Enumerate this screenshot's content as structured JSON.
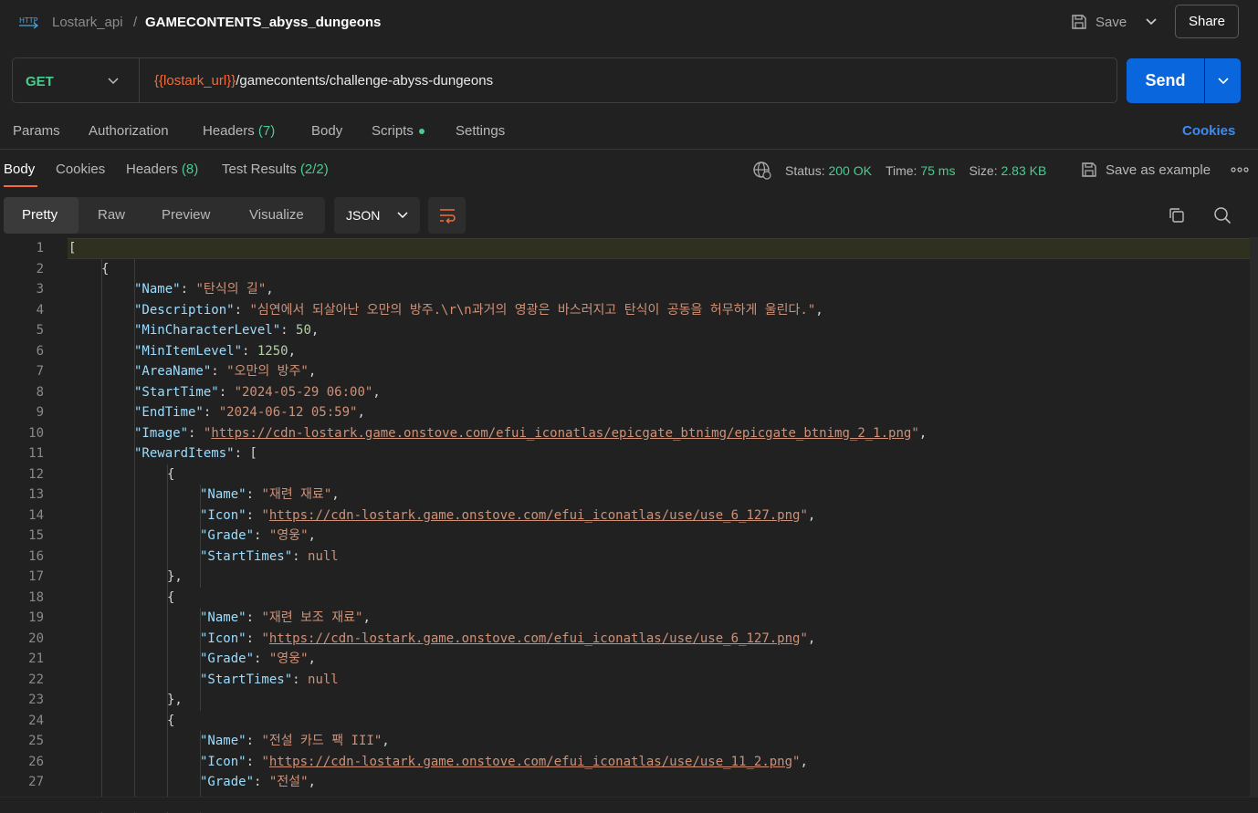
{
  "header": {
    "collection": "Lostark_api",
    "separator": "/",
    "title": "GAMECONTENTS_abyss_dungeons",
    "save_label": "Save",
    "share_label": "Share"
  },
  "request": {
    "method": "GET",
    "url_var": "{{lostark_url}}",
    "url_path": "/gamecontents/challenge-abyss-dungeons",
    "send_label": "Send"
  },
  "request_tabs": {
    "params": "Params",
    "authorization": "Authorization",
    "headers": "Headers",
    "headers_count": "(7)",
    "body": "Body",
    "scripts": "Scripts",
    "settings": "Settings",
    "cookies": "Cookies"
  },
  "response_tabs": {
    "body": "Body",
    "cookies": "Cookies",
    "headers": "Headers",
    "headers_count": "(8)",
    "tests": "Test Results",
    "tests_count": "(2/2)"
  },
  "status": {
    "status_label": "Status:",
    "status_value": "200 OK",
    "time_label": "Time:",
    "time_value": "75 ms",
    "size_label": "Size:",
    "size_value": "2.83 KB",
    "save_example": "Save as example"
  },
  "view": {
    "pretty": "Pretty",
    "raw": "Raw",
    "preview": "Preview",
    "visualize": "Visualize",
    "format": "JSON"
  },
  "code_lines": [
    {
      "n": "1",
      "indent": 0,
      "parts": [
        [
          "p",
          "["
        ]
      ]
    },
    {
      "n": "2",
      "indent": 1,
      "parts": [
        [
          "p",
          "{"
        ]
      ]
    },
    {
      "n": "3",
      "indent": 2,
      "parts": [
        [
          "k",
          "\"Name\""
        ],
        [
          "p",
          ": "
        ],
        [
          "s",
          "\"탄식의 길\""
        ],
        [
          "p",
          ","
        ]
      ]
    },
    {
      "n": "4",
      "indent": 2,
      "parts": [
        [
          "k",
          "\"Description\""
        ],
        [
          "p",
          ": "
        ],
        [
          "s",
          "\"심연에서 되살아난 오만의 방주.\\r\\n과거의 영광은 바스러지고 탄식이 공동을 허무하게 울린다.\""
        ],
        [
          "p",
          ","
        ]
      ]
    },
    {
      "n": "5",
      "indent": 2,
      "parts": [
        [
          "k",
          "\"MinCharacterLevel\""
        ],
        [
          "p",
          ": "
        ],
        [
          "n",
          "50"
        ],
        [
          "p",
          ","
        ]
      ]
    },
    {
      "n": "6",
      "indent": 2,
      "parts": [
        [
          "k",
          "\"MinItemLevel\""
        ],
        [
          "p",
          ": "
        ],
        [
          "n",
          "1250"
        ],
        [
          "p",
          ","
        ]
      ]
    },
    {
      "n": "7",
      "indent": 2,
      "parts": [
        [
          "k",
          "\"AreaName\""
        ],
        [
          "p",
          ": "
        ],
        [
          "s",
          "\"오만의 방주\""
        ],
        [
          "p",
          ","
        ]
      ]
    },
    {
      "n": "8",
      "indent": 2,
      "parts": [
        [
          "k",
          "\"StartTime\""
        ],
        [
          "p",
          ": "
        ],
        [
          "s",
          "\"2024-05-29 06:00\""
        ],
        [
          "p",
          ","
        ]
      ]
    },
    {
      "n": "9",
      "indent": 2,
      "parts": [
        [
          "k",
          "\"EndTime\""
        ],
        [
          "p",
          ": "
        ],
        [
          "s",
          "\"2024-06-12 05:59\""
        ],
        [
          "p",
          ","
        ]
      ]
    },
    {
      "n": "10",
      "indent": 2,
      "parts": [
        [
          "k",
          "\"Image\""
        ],
        [
          "p",
          ": "
        ],
        [
          "s",
          "\""
        ],
        [
          "u",
          "https://cdn-lostark.game.onstove.com/efui_iconatlas/epicgate_btnimg/epicgate_btnimg_2_1.png"
        ],
        [
          "s",
          "\""
        ],
        [
          "p",
          ","
        ]
      ]
    },
    {
      "n": "11",
      "indent": 2,
      "parts": [
        [
          "k",
          "\"RewardItems\""
        ],
        [
          "p",
          ": ["
        ]
      ]
    },
    {
      "n": "12",
      "indent": 3,
      "parts": [
        [
          "p",
          "{"
        ]
      ]
    },
    {
      "n": "13",
      "indent": 4,
      "parts": [
        [
          "k",
          "\"Name\""
        ],
        [
          "p",
          ": "
        ],
        [
          "s",
          "\"재련 재료\""
        ],
        [
          "p",
          ","
        ]
      ]
    },
    {
      "n": "14",
      "indent": 4,
      "parts": [
        [
          "k",
          "\"Icon\""
        ],
        [
          "p",
          ": "
        ],
        [
          "s",
          "\""
        ],
        [
          "u",
          "https://cdn-lostark.game.onstove.com/efui_iconatlas/use/use_6_127.png"
        ],
        [
          "s",
          "\""
        ],
        [
          "p",
          ","
        ]
      ]
    },
    {
      "n": "15",
      "indent": 4,
      "parts": [
        [
          "k",
          "\"Grade\""
        ],
        [
          "p",
          ": "
        ],
        [
          "s",
          "\"영웅\""
        ],
        [
          "p",
          ","
        ]
      ]
    },
    {
      "n": "16",
      "indent": 4,
      "parts": [
        [
          "k",
          "\"StartTimes\""
        ],
        [
          "p",
          ": "
        ],
        [
          "s",
          "null"
        ]
      ]
    },
    {
      "n": "17",
      "indent": 3,
      "parts": [
        [
          "p",
          "},"
        ]
      ]
    },
    {
      "n": "18",
      "indent": 3,
      "parts": [
        [
          "p",
          "{"
        ]
      ]
    },
    {
      "n": "19",
      "indent": 4,
      "parts": [
        [
          "k",
          "\"Name\""
        ],
        [
          "p",
          ": "
        ],
        [
          "s",
          "\"재련 보조 재료\""
        ],
        [
          "p",
          ","
        ]
      ]
    },
    {
      "n": "20",
      "indent": 4,
      "parts": [
        [
          "k",
          "\"Icon\""
        ],
        [
          "p",
          ": "
        ],
        [
          "s",
          "\""
        ],
        [
          "u",
          "https://cdn-lostark.game.onstove.com/efui_iconatlas/use/use_6_127.png"
        ],
        [
          "s",
          "\""
        ],
        [
          "p",
          ","
        ]
      ]
    },
    {
      "n": "21",
      "indent": 4,
      "parts": [
        [
          "k",
          "\"Grade\""
        ],
        [
          "p",
          ": "
        ],
        [
          "s",
          "\"영웅\""
        ],
        [
          "p",
          ","
        ]
      ]
    },
    {
      "n": "22",
      "indent": 4,
      "parts": [
        [
          "k",
          "\"StartTimes\""
        ],
        [
          "p",
          ": "
        ],
        [
          "s",
          "null"
        ]
      ]
    },
    {
      "n": "23",
      "indent": 3,
      "parts": [
        [
          "p",
          "},"
        ]
      ]
    },
    {
      "n": "24",
      "indent": 3,
      "parts": [
        [
          "p",
          "{"
        ]
      ]
    },
    {
      "n": "25",
      "indent": 4,
      "parts": [
        [
          "k",
          "\"Name\""
        ],
        [
          "p",
          ": "
        ],
        [
          "s",
          "\"전설 카드 팩 III\""
        ],
        [
          "p",
          ","
        ]
      ]
    },
    {
      "n": "26",
      "indent": 4,
      "parts": [
        [
          "k",
          "\"Icon\""
        ],
        [
          "p",
          ": "
        ],
        [
          "s",
          "\""
        ],
        [
          "u",
          "https://cdn-lostark.game.onstove.com/efui_iconatlas/use/use_11_2.png"
        ],
        [
          "s",
          "\""
        ],
        [
          "p",
          ","
        ]
      ]
    },
    {
      "n": "27",
      "indent": 4,
      "parts": [
        [
          "k",
          "\"Grade\""
        ],
        [
          "p",
          ": "
        ],
        [
          "s",
          "\"전설\""
        ],
        [
          "p",
          ","
        ]
      ]
    }
  ],
  "colors": {
    "accent_blue": "#0a66dd",
    "success_green": "#49cc90",
    "orange": "#f26b3a"
  },
  "icons": [
    "http-icon",
    "save-icon",
    "chevron-down-icon",
    "globe-icon",
    "save-example-icon",
    "more-icon",
    "wrap-icon",
    "copy-icon",
    "search-icon"
  ]
}
